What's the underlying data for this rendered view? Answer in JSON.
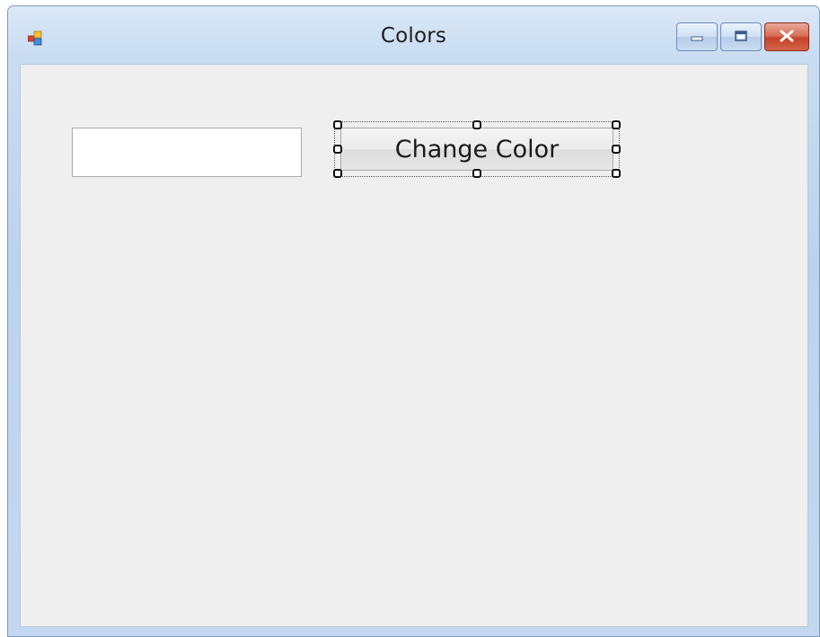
{
  "window": {
    "title": "Colors",
    "icon": "winforms-form-icon",
    "controls": {
      "minimize_icon": "minimize-icon",
      "maximize_icon": "maximize-icon",
      "close_icon": "close-icon"
    }
  },
  "form": {
    "textbox": {
      "value": "",
      "placeholder": ""
    },
    "button": {
      "label": "Change Color",
      "selected_in_designer": true
    }
  },
  "colors": {
    "client_background": "#efefef",
    "frame": "#bcd3ee",
    "close_button": "#c4442a"
  }
}
